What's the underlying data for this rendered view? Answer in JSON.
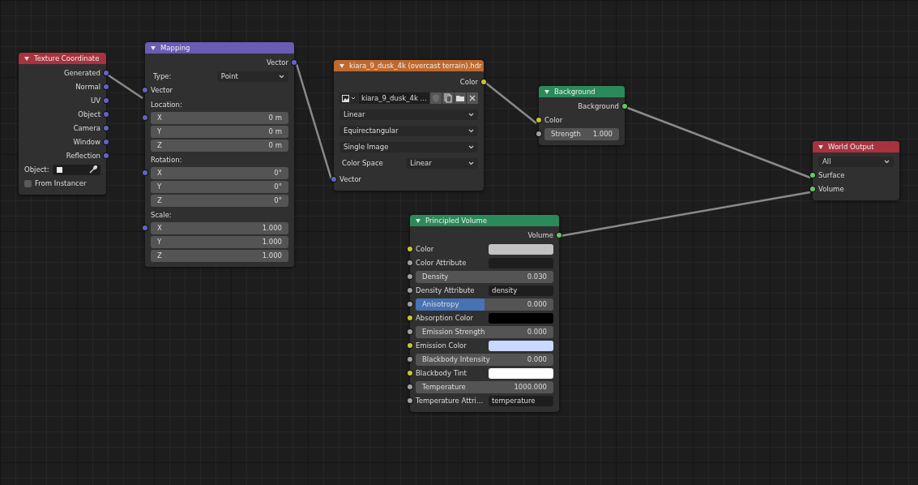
{
  "nodes": [
    {
      "title": "Texture Coordinate",
      "color": "#a8323e",
      "rows": [
        {
          "kind": "output",
          "label": "Generated",
          "socket": {
            "color": "#6363c7"
          }
        },
        {
          "kind": "output",
          "label": "Normal",
          "socket": {
            "color": "#6363c7"
          }
        },
        {
          "kind": "output",
          "label": "UV",
          "socket": {
            "color": "#6363c7"
          }
        },
        {
          "kind": "output",
          "label": "Object",
          "socket": {
            "color": "#6363c7"
          }
        },
        {
          "kind": "output",
          "label": "Camera",
          "socket": {
            "color": "#6363c7"
          }
        },
        {
          "kind": "output",
          "label": "Window",
          "socket": {
            "color": "#6363c7"
          }
        },
        {
          "kind": "output",
          "label": "Reflection",
          "socket": {
            "color": "#6363c7"
          }
        },
        {
          "kind": "object",
          "label": "Object:"
        },
        {
          "kind": "checkbox",
          "label": "From Instancer",
          "checked": false
        }
      ]
    },
    {
      "title": "Mapping",
      "color": "#6a5bb3",
      "rows": [
        {
          "kind": "output",
          "label": "Vector",
          "socket": {
            "color": "#6363c7"
          }
        },
        {
          "kind": "dropdown",
          "label": "Type:",
          "value": "Point"
        },
        {
          "kind": "input",
          "label": "Vector",
          "socket": {
            "color": "#6363c7"
          }
        },
        {
          "kind": "heading",
          "label": "Location:"
        },
        {
          "kind": "field",
          "label": "X",
          "value": "0 m",
          "socket": {
            "color": "#6363c7"
          }
        },
        {
          "kind": "field",
          "label": "Y",
          "value": "0 m"
        },
        {
          "kind": "field",
          "label": "Z",
          "value": "0 m"
        },
        {
          "kind": "heading",
          "label": "Rotation:"
        },
        {
          "kind": "field",
          "label": "X",
          "value": "0°",
          "socket": {
            "color": "#6363c7"
          }
        },
        {
          "kind": "field",
          "label": "Y",
          "value": "0°"
        },
        {
          "kind": "field",
          "label": "Z",
          "value": "0°"
        },
        {
          "kind": "heading",
          "label": "Scale:"
        },
        {
          "kind": "field",
          "label": "X",
          "value": "1.000",
          "socket": {
            "color": "#6363c7"
          }
        },
        {
          "kind": "field",
          "label": "Y",
          "value": "1.000"
        },
        {
          "kind": "field",
          "label": "Z",
          "value": "1.000"
        }
      ]
    },
    {
      "title": "kiara_9_dusk_4k (overcast terrain).hdr",
      "color": "#c0692d",
      "rows": [
        {
          "kind": "output",
          "label": "Color",
          "socket": {
            "color": "#c7c729"
          }
        },
        {
          "kind": "image",
          "value": "kiara_9_dusk_4k ..."
        },
        {
          "kind": "dropdown",
          "value": "Linear"
        },
        {
          "kind": "dropdown",
          "value": "Equirectangular"
        },
        {
          "kind": "dropdown",
          "value": "Single Image"
        },
        {
          "kind": "dropdown",
          "label": "Color Space",
          "value": "Linear"
        },
        {
          "kind": "input",
          "label": "Vector",
          "socket": {
            "color": "#6363c7"
          }
        }
      ]
    },
    {
      "title": "Background",
      "color": "#2a8a5a",
      "rows": [
        {
          "kind": "output",
          "label": "Background",
          "socket": {
            "color": "#63c763"
          }
        },
        {
          "kind": "input",
          "label": "Color",
          "socket": {
            "color": "#c7c729"
          }
        },
        {
          "kind": "field",
          "label": "Strength",
          "value": "1.000",
          "socket": {
            "color": "#a1a1a1"
          }
        }
      ]
    },
    {
      "title": "World Output",
      "color": "#a8323e",
      "rows": [
        {
          "kind": "dropdown",
          "value": "All"
        },
        {
          "kind": "input",
          "label": "Surface",
          "socket": {
            "color": "#63c763"
          }
        },
        {
          "kind": "input",
          "label": "Volume",
          "socket": {
            "color": "#63c763"
          }
        }
      ]
    },
    {
      "title": "Principled Volume",
      "color": "#2a8a5a",
      "rows": [
        {
          "kind": "output",
          "label": "Volume",
          "socket": {
            "color": "#63c763"
          }
        },
        {
          "kind": "color",
          "label": "Color",
          "color": "#c2c2c2",
          "socket": {
            "color": "#c7c729"
          }
        },
        {
          "kind": "text",
          "label": "Color Attribute",
          "socket": {
            "color": "#a1a1a1"
          }
        },
        {
          "kind": "field",
          "label": "Density",
          "value": "0.030",
          "socket": {
            "color": "#a1a1a1"
          }
        },
        {
          "kind": "text",
          "label": "Density Attribute",
          "value": "density",
          "socket": {
            "color": "#a1a1a1"
          }
        },
        {
          "kind": "slider",
          "label": "Anisotropy",
          "value": "0.000",
          "level": 0.5,
          "socket": {
            "color": "#a1a1a1"
          }
        },
        {
          "kind": "color",
          "label": "Absorption Color",
          "color": "#000000",
          "socket": {
            "color": "#c7c729"
          }
        },
        {
          "kind": "field",
          "label": "Emission Strength",
          "value": "0.000",
          "socket": {
            "color": "#a1a1a1"
          }
        },
        {
          "kind": "color",
          "label": "Emission Color",
          "color": "#c8d8ff",
          "socket": {
            "color": "#c7c729"
          }
        },
        {
          "kind": "field",
          "label": "Blackbody Intensity",
          "value": "0.000",
          "socket": {
            "color": "#a1a1a1"
          }
        },
        {
          "kind": "color",
          "label": "Blackbody Tint",
          "color": "#ffffff",
          "socket": {
            "color": "#c7c729"
          }
        },
        {
          "kind": "field",
          "label": "Temperature",
          "value": "1000.000",
          "socket": {
            "color": "#a1a1a1"
          }
        },
        {
          "kind": "text",
          "label": "Temperature Attri…",
          "value": "temperature",
          "socket": {
            "color": "#a1a1a1"
          }
        }
      ]
    }
  ]
}
